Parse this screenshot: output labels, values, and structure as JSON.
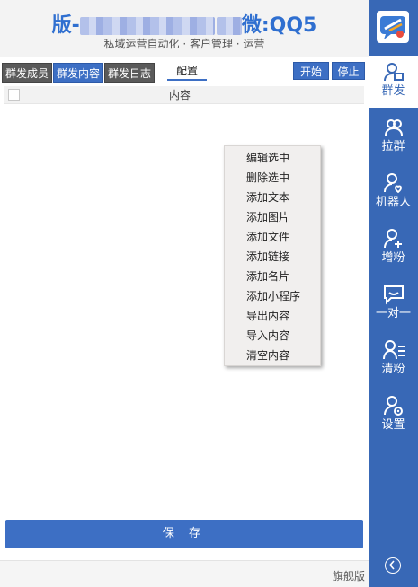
{
  "header": {
    "title_left": "版-",
    "title_right": "微:QQ5",
    "subtitle": "私域运营自动化 · 客户管理 · 运营"
  },
  "tabs": [
    {
      "label": "群发成员"
    },
    {
      "label": "群发内容"
    },
    {
      "label": "群发日志"
    }
  ],
  "config_label": "配置",
  "buttons": {
    "start": "开始",
    "stop": "停止",
    "save": "保 存"
  },
  "table": {
    "column_content": "内容"
  },
  "context_menu": [
    "编辑选中",
    "删除选中",
    "添加文本",
    "添加图片",
    "添加文件",
    "添加链接",
    "添加名片",
    "添加小程序",
    "导出内容",
    "导入内容",
    "清空内容"
  ],
  "footer": {
    "edition": "旗舰版"
  },
  "sidebar": [
    {
      "label": "群发",
      "icon": "person-broadcast-icon"
    },
    {
      "label": "拉群",
      "icon": "group-icon"
    },
    {
      "label": "机器人",
      "icon": "robot-person-icon"
    },
    {
      "label": "增粉",
      "icon": "add-person-icon"
    },
    {
      "label": "一对一",
      "icon": "chat-icon"
    },
    {
      "label": "清粉",
      "icon": "person-list-icon"
    },
    {
      "label": "设置",
      "icon": "person-gear-icon"
    }
  ],
  "colors": {
    "accent": "#3868b6",
    "button": "#3d6fc4",
    "menu_bg": "#f1efee"
  }
}
